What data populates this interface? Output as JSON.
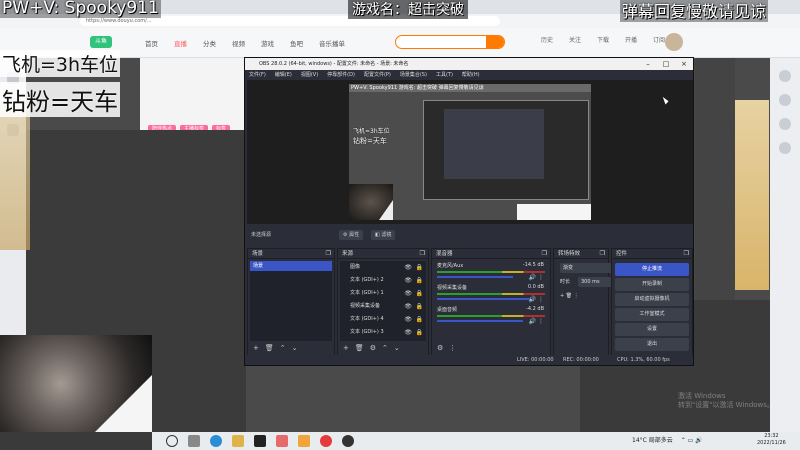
{
  "overlay": {
    "top_left": "PW+V: Spooky911",
    "game_name": "游戏名：超击突破",
    "top_right": "弹幕回复慢敬请见谅",
    "plane": "飞机=3h车位",
    "diamond": "钻粉=天车"
  },
  "browser": {
    "url": "https://www.douyu.com/...",
    "nav": [
      "首页",
      "直播",
      "分类",
      "视频",
      "游戏",
      "鱼吧",
      "音乐播单"
    ],
    "nav_active_index": 1,
    "site_icons": [
      "历史",
      "关注",
      "下载",
      "开播",
      "订阅"
    ],
    "tags": [
      "陪伴热点",
      "主播标签",
      "标签"
    ]
  },
  "obs": {
    "title": "OBS 28.0.2 (64-bit, windows) - 配置文件: 未命名 - 场景: 未命名",
    "menu": [
      "文件(F)",
      "编辑(E)",
      "视图(V)",
      "停靠部件(D)",
      "配置文件(P)",
      "场景集合(S)",
      "工具(T)",
      "帮助(H)"
    ],
    "no_source": "未选择源",
    "props_btn": "属性",
    "filters_btn": "滤镜",
    "preview_top": "PW+V: Spooky911    游戏名: 超击突破              弹幕回复慢敬请见谅",
    "preview_plane": "飞机=3h车位",
    "preview_diamond": "钻粉=天车",
    "docks": {
      "scenes": {
        "title": "场景",
        "items": [
          "场景"
        ]
      },
      "sources": {
        "title": "来源",
        "items": [
          "图像",
          "文本 (GDI+) 2",
          "文本 (GDI+) 1",
          "视频采集设备",
          "文本 (GDI+) 4",
          "文本 (GDI+) 3"
        ]
      },
      "mixer": {
        "title": "混音器",
        "tracks": [
          {
            "name": "麦克风/Aux",
            "db": "-14.5 dB"
          },
          {
            "name": "视频采集设备",
            "db": "0.0 dB"
          },
          {
            "name": "桌面音频",
            "db": "-4.2 dB"
          }
        ]
      },
      "transitions": {
        "title": "转场特效",
        "type": "渐变",
        "duration_label": "时长",
        "duration": "300 ms"
      },
      "controls": {
        "title": "控件",
        "buttons": [
          "停止推流",
          "开始录制",
          "启动虚拟摄像机",
          "工作室模式",
          "设置",
          "退出"
        ]
      }
    },
    "status": {
      "live": "LIVE: 00:00:00",
      "rec": "REC: 00:00:00",
      "cpu": "CPU: 1.3%, 60.00 fps"
    }
  },
  "taskbar": {
    "weather": "14°C  局部多云",
    "time": "23:32",
    "date": "2022/11/26"
  },
  "watermark": {
    "line1": "激活 Windows",
    "line2": "转到\"设置\"以激活 Windows。"
  }
}
